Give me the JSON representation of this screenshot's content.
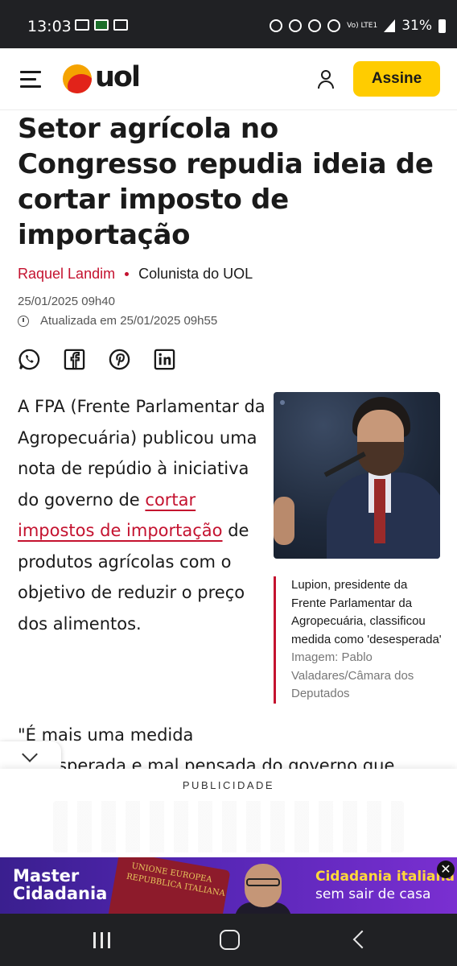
{
  "status_bar": {
    "time": "13:03",
    "battery": "31%",
    "network": "Vo) LTE1"
  },
  "header": {
    "logo_text": "uol",
    "subscribe_label": "Assine"
  },
  "article": {
    "title": "Setor agrícola no Congresso repudia ideia de cortar imposto de importação",
    "author": "Raquel Landim",
    "author_role": "Colunista do UOL",
    "published": "25/01/2025 09h40",
    "updated": "Atualizada em 25/01/2025 09h55",
    "share_icons": [
      "whatsapp-icon",
      "facebook-icon",
      "pinterest-icon",
      "linkedin-icon"
    ],
    "paragraph_before_link": "A FPA (Frente Parlamentar da Agropecuária) publicou uma nota de repúdio à iniciativa do governo de ",
    "paragraph_link": "cortar impostos de importação",
    "paragraph_after_link": " de produtos agrícolas com o objetivo de reduzir o preço dos alimentos.",
    "image_caption": "Lupion, presidente da Frente Parlamentar da Agropecuária, classificou medida como 'desesperada'",
    "image_credit": "Imagem: Pablo Valadares/Câmara dos Deputados",
    "quote_line1": "\"É mais uma medida",
    "quote_line2": "desesperada e mal pensada do governo que"
  },
  "ad": {
    "label": "PUBLICIDADE",
    "banner_brand_line1": "Master",
    "banner_brand_line2": "Cidadania",
    "passport_line1": "UNIONE EUROPEA",
    "passport_line2": "REPUBBLICA ITALIANA",
    "banner_headline": "Cidadania italiana",
    "banner_subline": "sem sair de casa",
    "close_label": "✕"
  },
  "colors": {
    "accent": "#c4122f",
    "subscribe_button": "#ffcc00",
    "banner_purple": "#5526b4"
  }
}
